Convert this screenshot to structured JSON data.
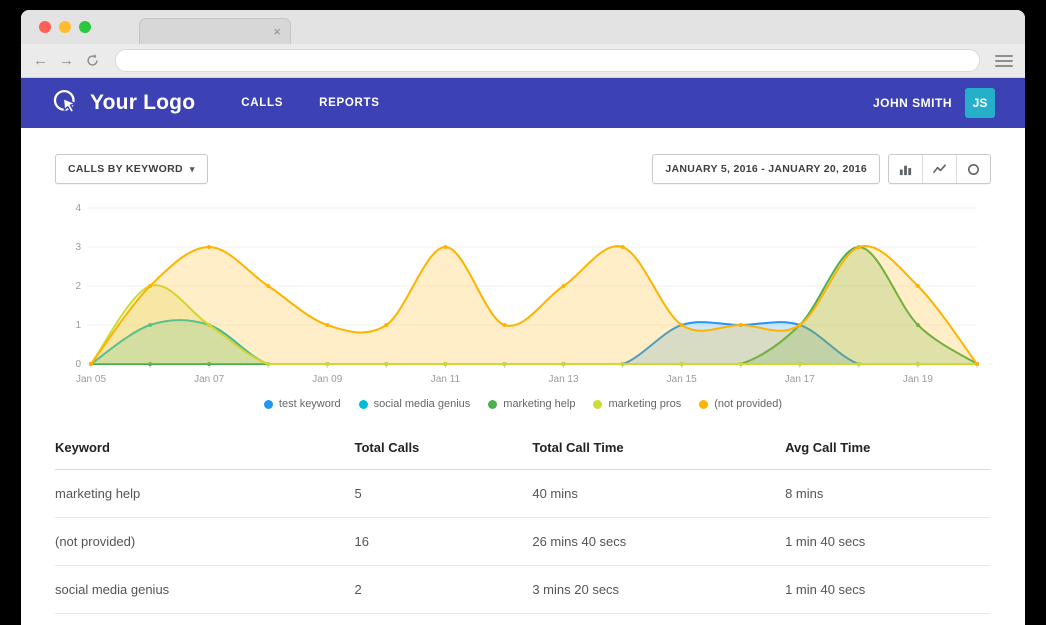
{
  "browser": {
    "tab_title": "",
    "tab_close_glyph": "×",
    "back_glyph": "←",
    "forward_glyph": "→",
    "address_value": ""
  },
  "navbar": {
    "logo_text": "Your Logo",
    "items": [
      {
        "label": "CALLS"
      },
      {
        "label": "REPORTS"
      }
    ],
    "user_name": "JOHN SMITH",
    "avatar_initials": "JS",
    "bg_color": "#3c41b4",
    "avatar_color": "#26afc8"
  },
  "controls": {
    "keyword_dropdown_label": "CALLS BY KEYWORD",
    "dropdown_caret": "▾",
    "date_range_label": "JANUARY 5, 2016 - JANUARY 20, 2016",
    "view_toggles": [
      "bar-chart",
      "line-chart",
      "donut-chart"
    ]
  },
  "chart_data": {
    "type": "area",
    "x": [
      "Jan 05",
      "Jan 06",
      "Jan 07",
      "Jan 08",
      "Jan 09",
      "Jan 10",
      "Jan 11",
      "Jan 12",
      "Jan 13",
      "Jan 14",
      "Jan 15",
      "Jan 16",
      "Jan 17",
      "Jan 18",
      "Jan 19",
      "Jan 20"
    ],
    "x_axis_tick_labels": [
      "Jan 05",
      "Jan 07",
      "Jan 09",
      "Jan 11",
      "Jan 13",
      "Jan 15",
      "Jan 17",
      "Jan 19"
    ],
    "ylim": [
      0,
      4
    ],
    "y_ticks": [
      0,
      1,
      2,
      3,
      4
    ],
    "grid": true,
    "legend_position": "bottom",
    "series": [
      {
        "name": "test keyword",
        "color": "#2196f3",
        "values": [
          0,
          0,
          0,
          0,
          0,
          0,
          0,
          0,
          0,
          0,
          1,
          1,
          1,
          0,
          0,
          0
        ]
      },
      {
        "name": "social media genius",
        "color": "#00bcd4",
        "values": [
          0,
          1,
          1,
          0,
          0,
          0,
          0,
          0,
          0,
          0,
          0,
          0,
          0,
          0,
          0,
          0
        ]
      },
      {
        "name": "marketing help",
        "color": "#4caf50",
        "values": [
          0,
          0,
          0,
          0,
          0,
          0,
          0,
          0,
          0,
          0,
          0,
          0,
          1,
          3,
          1,
          0
        ]
      },
      {
        "name": "marketing pros",
        "color": "#cddc39",
        "values": [
          0,
          2,
          1,
          0,
          0,
          0,
          0,
          0,
          0,
          0,
          0,
          0,
          0,
          0,
          0,
          0
        ]
      },
      {
        "name": "(not provided)",
        "color": "#ffb300",
        "values": [
          0,
          2,
          3,
          2,
          1,
          1,
          3,
          1,
          2,
          3,
          1,
          1,
          1,
          3,
          2,
          0
        ]
      }
    ]
  },
  "table": {
    "headers": [
      "Keyword",
      "Total Calls",
      "Total Call Time",
      "Avg Call Time"
    ],
    "rows": [
      {
        "keyword": "marketing help",
        "total_calls": "5",
        "total_call_time": "40 mins",
        "avg_call_time": "8 mins"
      },
      {
        "keyword": "(not provided)",
        "total_calls": "16",
        "total_call_time": "26 mins 40 secs",
        "avg_call_time": "1 min 40 secs"
      },
      {
        "keyword": "social media genius",
        "total_calls": "2",
        "total_call_time": "3 mins 20 secs",
        "avg_call_time": "1 min 40 secs"
      }
    ]
  }
}
